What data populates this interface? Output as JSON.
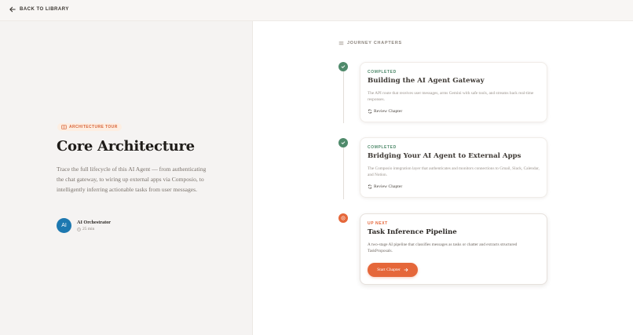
{
  "nav": {
    "back_label": "BACK TO LIBRARY"
  },
  "hero": {
    "tag": "ARCHITECTURE TOUR",
    "title": "Core Architecture",
    "description": "Trace the full lifecycle of this AI Agent — from authenticating the chat gateway, to wiring up external apps via Composio, to intelligently inferring actionable tasks from user messages.",
    "author": {
      "initials": "AI",
      "name": "AI Orchestrator",
      "duration": "25 min"
    }
  },
  "journey": {
    "heading": "JOURNEY CHAPTERS",
    "chapters": [
      {
        "status": "COMPLETED",
        "title": "Building the AI Agent Gateway",
        "description": "The API route that receives user messages, arms Gemini with safe tools, and streams back real-time responses.",
        "action": "Review Chapter"
      },
      {
        "status": "COMPLETED",
        "title": "Bridging Your AI Agent to External Apps",
        "description": "The Composio integration layer that authenticates and monitors connections to Gmail, Slack, Calendar, and Notion.",
        "action": "Review Chapter"
      },
      {
        "status": "UP NEXT",
        "title": "Task Inference Pipeline",
        "description": "A two-stage AI pipeline that classifies messages as tasks or chatter and extracts structured TaskProposals.",
        "action": "Start Chapter"
      }
    ]
  },
  "colors": {
    "accent": "#e5673a",
    "completed": "#4f8a6b",
    "avatar": "#1d78b0"
  }
}
